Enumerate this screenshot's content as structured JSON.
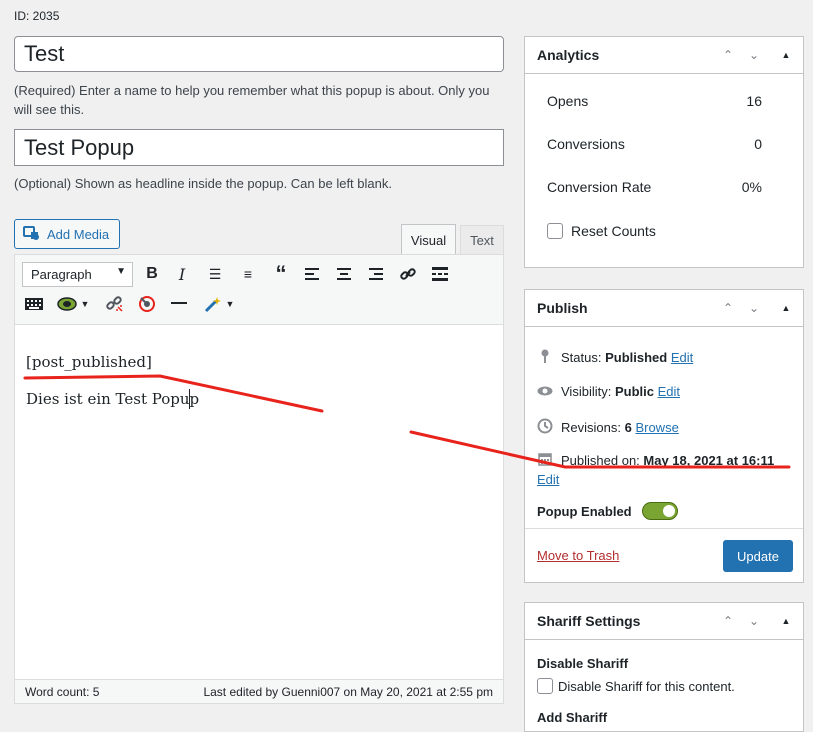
{
  "post_id": "ID: 2035",
  "title": {
    "value": "Test",
    "help": "(Required) Enter a name to help you remember what this popup is about. Only you will see this."
  },
  "headline": {
    "value": "Test Popup",
    "help": "(Optional) Shown as headline inside the popup. Can be left blank."
  },
  "editor": {
    "add_media_label": "Add Media",
    "tabs": {
      "visual": "Visual",
      "text": "Text"
    },
    "format_select": "Paragraph",
    "content": [
      "[post_published]",
      "Dies ist ein Test Popup"
    ],
    "word_count": "Word count: 5",
    "last_edited": "Last edited by Guenni007 on May 20, 2021 at 2:55 pm"
  },
  "analytics": {
    "title": "Analytics",
    "rows": [
      {
        "label": "Opens",
        "value": "16"
      },
      {
        "label": "Conversions",
        "value": "0"
      },
      {
        "label": "Conversion Rate",
        "value": "0%"
      }
    ],
    "reset_label": "Reset Counts"
  },
  "publish": {
    "title": "Publish",
    "status_label": "Status:",
    "status_value": "Published",
    "status_edit": "Edit",
    "visibility_label": "Visibility:",
    "visibility_value": "Public",
    "visibility_edit": "Edit",
    "revisions_label": "Revisions:",
    "revisions_value": "6",
    "revisions_browse": "Browse",
    "published_label": "Published on:",
    "published_value": "May 18, 2021 at 16:11",
    "published_edit": "Edit",
    "popup_enabled_label": "Popup Enabled",
    "popup_enabled": true,
    "trash_label": "Move to Trash",
    "update_label": "Update"
  },
  "shariff": {
    "title": "Shariff Settings",
    "disable_heading": "Disable Shariff",
    "disable_checkbox": "Disable Shariff for this content.",
    "add_heading": "Add Shariff"
  },
  "colors": {
    "accent": "#2271b1",
    "toggle_on": "#7ba533",
    "annotation": "#e8231b",
    "danger": "#b32d2e"
  }
}
